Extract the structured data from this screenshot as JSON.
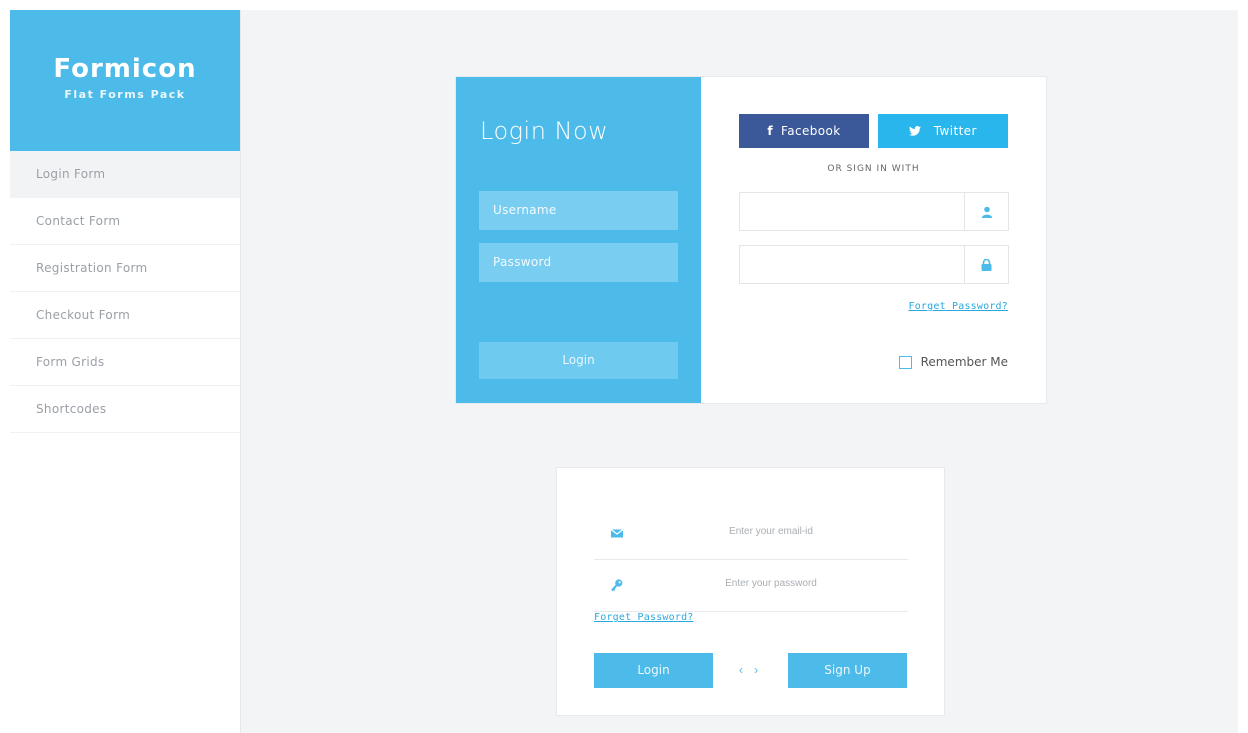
{
  "sidebar": {
    "brand_title": "Formicon",
    "brand_subtitle": "Flat Forms Pack",
    "items": [
      {
        "label": "Login Form",
        "active": true
      },
      {
        "label": "Contact Form"
      },
      {
        "label": "Registration Form"
      },
      {
        "label": "Checkout Form"
      },
      {
        "label": "Form Grids"
      },
      {
        "label": "Shortcodes"
      }
    ]
  },
  "login_card": {
    "title": "Login Now",
    "username_placeholder": "Username",
    "password_placeholder": "Password",
    "login_label": "Login",
    "facebook_label": "Facebook",
    "twitter_label": "Twitter",
    "or_text": "OR SIGN IN WITH",
    "forget_label": "Forget Password?",
    "remember_label": "Remember Me"
  },
  "simple_card": {
    "email_placeholder": "Enter your email-id",
    "password_placeholder": "Enter your password",
    "forget_label": "Forget Password?",
    "login_label": "Login",
    "arrows": "‹ ›",
    "signup_label": "Sign Up"
  },
  "colors": {
    "accent": "#4dbbe9",
    "facebook": "#3b5998",
    "twitter": "#29b6ec"
  },
  "icons": [
    "facebook-icon",
    "twitter-icon",
    "user-icon",
    "lock-icon",
    "mail-icon",
    "key-icon"
  ]
}
